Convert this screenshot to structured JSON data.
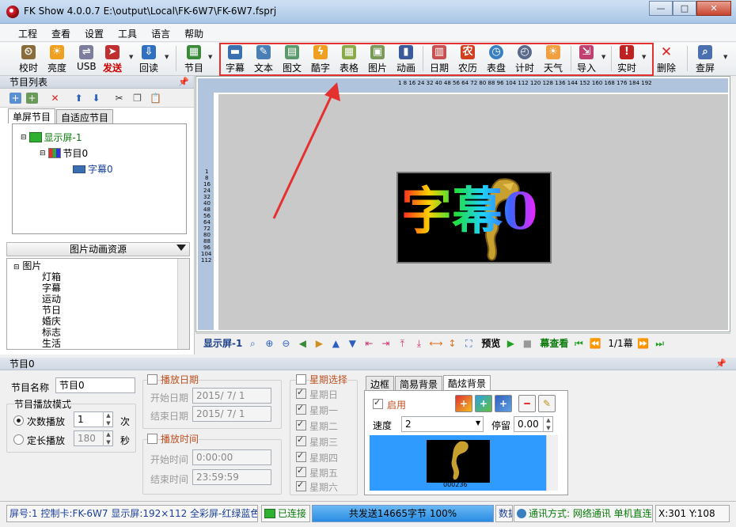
{
  "window": {
    "title": "FK Show 4.0.0.7 E:\\output\\Local\\FK-6W7\\FK-6W7.fsprj",
    "minimize": "—",
    "maximize": "□",
    "close": "✕"
  },
  "menu": [
    "工程",
    "查看",
    "设置",
    "工具",
    "语言",
    "帮助"
  ],
  "toolbar": {
    "left": [
      "校时",
      "亮度",
      "USB",
      "发送",
      "回读",
      "节目"
    ],
    "content": [
      "字幕",
      "文本",
      "图文",
      "酷字",
      "表格",
      "图片",
      "动画",
      "日期",
      "农历",
      "表盘",
      "计时",
      "天气",
      "导入",
      "实时"
    ],
    "right": [
      "删除",
      "查屏"
    ]
  },
  "program_list": {
    "title": "节目列表",
    "tabs": [
      "单屏节目",
      "自适应节目"
    ],
    "tree": {
      "screen": "显示屏-1",
      "program": "节目0",
      "item": "字幕0"
    }
  },
  "resources": {
    "title": "图片动画资源",
    "root": "图片",
    "items": [
      "灯箱",
      "字幕",
      "运动",
      "节日",
      "婚庆",
      "标志",
      "生活"
    ]
  },
  "canvas": {
    "top_ruler": "1 8 16 24 32 40 48 56 64 72 80 88 96 104 112 120 128 136 144 152 160 168 176 184 192",
    "left_ruler": [
      "1",
      "8",
      "16",
      "24",
      "32",
      "40",
      "48",
      "56",
      "64",
      "72",
      "80",
      "88",
      "96",
      "104",
      "112"
    ],
    "led_text": "字幕0"
  },
  "navbar": {
    "screen": "显示屏-1",
    "preview": "预览",
    "scene": "幕查看",
    "page": "1/1幕"
  },
  "bottom": {
    "header": "节目0",
    "name_label": "节目名称",
    "name_value": "节目0",
    "mode_label": "节目播放模式",
    "count_label": "次数播放",
    "count_value": "1",
    "count_unit": "次",
    "fixed_label": "定长播放",
    "fixed_value": "180",
    "fixed_unit": "秒",
    "date_label": "播放日期",
    "start_date_label": "开始日期",
    "start_date": "2015/ 7/ 1",
    "end_date_label": "结束日期",
    "end_date": "2015/ 7/ 1",
    "time_label": "播放时间",
    "start_time_label": "开始时间",
    "start_time": "0:00:00",
    "end_time_label": "结束时间",
    "end_time": "23:59:59",
    "week_label": "星期选择",
    "weekdays": [
      "星期日",
      "星期一",
      "星期二",
      "星期三",
      "星期四",
      "星期五",
      "星期六"
    ],
    "bg_tabs": [
      "边框",
      "简易背景",
      "酷炫背景"
    ],
    "enable_label": "启用",
    "speed_label": "速度",
    "speed_value": "2",
    "stay_label": "停留",
    "stay_value": "0.00",
    "preview_caption": "000236"
  },
  "status": {
    "info": "屏号:1 控制卡:FK-6W7 显示屏:192×112 全彩屏-红绿蓝色",
    "connected": "已连接",
    "progress_text": "共发送14665字节 100%",
    "progress_percent": 100,
    "data": "数据",
    "comm": "通讯方式: 网络通讯 单机直连",
    "coords": "X:301 Y:108"
  }
}
